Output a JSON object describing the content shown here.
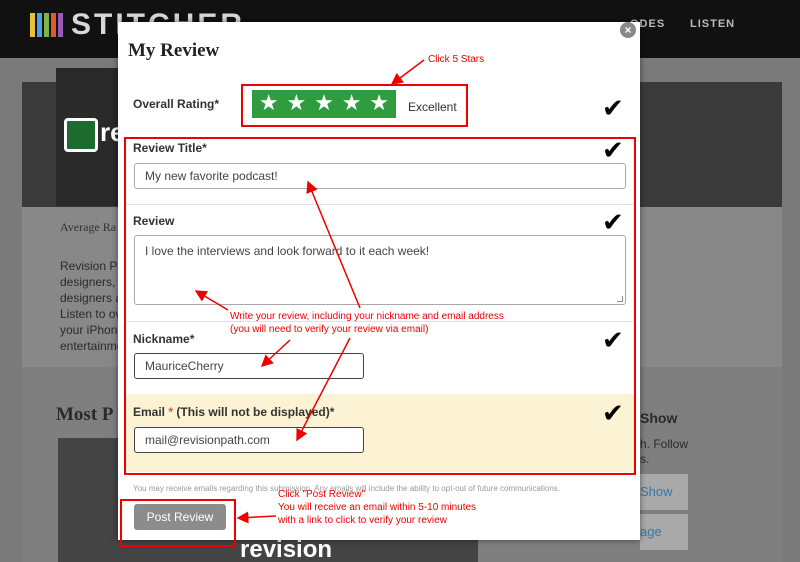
{
  "site": {
    "logo_text": "STITCHER",
    "logo_colors": [
      "#e8c23a",
      "#4aa3df",
      "#7ab648",
      "#e05a2b",
      "#9b59b6"
    ],
    "nav": [
      "ODES",
      "LISTEN"
    ]
  },
  "background": {
    "cover_text": "re",
    "average_label": "Average Ra",
    "description_lines": [
      "Revision Pa",
      "designers,",
      "designers a",
      "Listen to ov",
      "your iPhone",
      "entertainme"
    ],
    "most_heading": "Most P",
    "episode_text": "revision",
    "right_heading": "Show",
    "right_lines": [
      "h. Follow",
      "s."
    ],
    "right_btn_1": "Show",
    "right_btn_2": "age"
  },
  "modal": {
    "title": "My Review",
    "close_label": "×",
    "overall_rating": {
      "label": "Overall Rating*",
      "stars_selected": 5,
      "stars_total": 5,
      "rating_text": "Excellent",
      "star_color": "#2e9c3f"
    },
    "review_title": {
      "label": "Review Title*",
      "value": "My new favorite podcast!"
    },
    "review": {
      "label": "Review",
      "value": "I love the interviews and look forward to it each week!"
    },
    "nickname": {
      "label": "Nickname*",
      "value": "MauriceCherry"
    },
    "email": {
      "label_prefix": "Email ",
      "label_star": "*",
      "label_suffix": " (This will not be displayed)*",
      "value": "mail@revisionpath.com"
    },
    "disclaimer": "You may receive emails regarding this submission. Any emails will include the ability to opt-out of future communications.",
    "post_button": "Post Review",
    "checkmark": "✔"
  },
  "annotations": {
    "color": "#e00000",
    "click_stars": "Click 5 Stars",
    "write_review": [
      "Write your review, including your nickname and email address",
      "(you will need to verify your review via email)"
    ],
    "post_note": [
      "Click \"Post Review\"",
      "You will receive an email within 5-10 minutes",
      "with a link to click to verify your review"
    ]
  }
}
